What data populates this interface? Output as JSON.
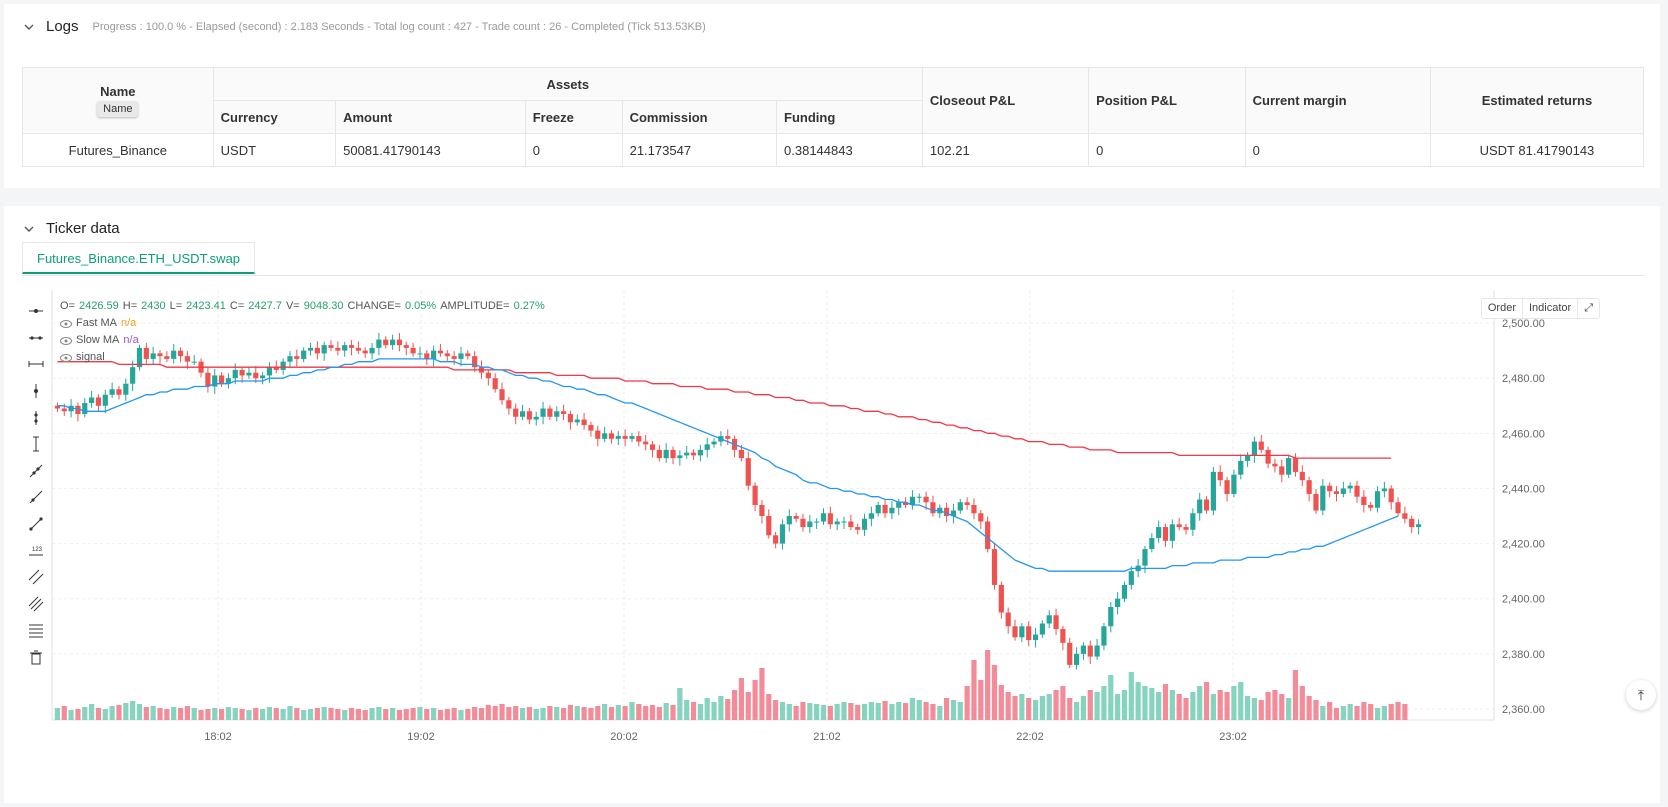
{
  "logs": {
    "title": "Logs",
    "meta": "Progress : 100.0 % - Elapsed (second) : 2.183  Seconds - Total log count : 427 - Trade count : 26 - Completed (Tick 513.53KB)"
  },
  "assets_table": {
    "name_header": "Name",
    "name_tooltip": "Name",
    "assets_header": "Assets",
    "sub_headers": [
      "Currency",
      "Amount",
      "Freeze",
      "Commission",
      "Funding"
    ],
    "other_headers": [
      "Closeout P&L",
      "Position P&L",
      "Current margin",
      "Estimated returns"
    ],
    "row": {
      "name": "Futures_Binance",
      "currency": "USDT",
      "amount": "50081.41790143",
      "freeze": "0",
      "commission": "21.173547",
      "funding": "0.38144843",
      "closeout_pl": "102.21",
      "position_pl": "0",
      "current_margin": "0",
      "estimated_returns": "USDT 81.41790143"
    }
  },
  "ticker": {
    "title": "Ticker data",
    "tab_label": "Futures_Binance.ETH_USDT.swap",
    "buttons": [
      "Order",
      "Indicator"
    ],
    "ohlc": {
      "o_label": "O=",
      "o": "2426.59",
      "h_label": "H=",
      "h": "2430",
      "l_label": "L=",
      "l": "2423.41",
      "c_label": "C=",
      "c": "2427.7",
      "v_label": "V=",
      "v": "9048.30",
      "change_label": "CHANGE=",
      "change": "0.05%",
      "amp_label": "AMPLITUDE=",
      "amp": "0.27%"
    },
    "legend": [
      {
        "name": "Fast MA",
        "value": "n/a",
        "color": "#f0a020"
      },
      {
        "name": "Slow MA",
        "value": "n/a",
        "color": "#9b59b6"
      },
      {
        "name": "signal",
        "value": ""
      }
    ]
  },
  "colors": {
    "up": "#26a69a",
    "down": "#ef5350",
    "fast_ma": "#2196f3",
    "slow_ma": "#f23645",
    "accent": "#0aa07a"
  },
  "chart_data": {
    "type": "candlestick",
    "x_ticks": [
      "18:02",
      "19:02",
      "20:02",
      "21:02",
      "22:02",
      "23:02"
    ],
    "y_ticks": [
      "2,500.00",
      "2,480.00",
      "2,460.00",
      "2,440.00",
      "2,420.00",
      "2,400.00",
      "2,380.00",
      "2,360.00"
    ],
    "y_tick_values": [
      2500,
      2480,
      2460,
      2440,
      2420,
      2400,
      2380,
      2360
    ],
    "ylim": [
      2356,
      2512
    ],
    "closes": [
      2469,
      2468,
      2470,
      2467,
      2471,
      2473,
      2470,
      2474,
      2476,
      2474,
      2478,
      2484,
      2491,
      2487,
      2489,
      2488,
      2487,
      2490,
      2488,
      2486,
      2486,
      2482,
      2477,
      2481,
      2478,
      2480,
      2483,
      2481,
      2482,
      2480,
      2481,
      2484,
      2483,
      2486,
      2488,
      2487,
      2490,
      2491,
      2489,
      2492,
      2491,
      2490,
      2492,
      2491,
      2490,
      2489,
      2491,
      2494,
      2492,
      2494,
      2492,
      2491,
      2489,
      2489,
      2487,
      2490,
      2489,
      2488,
      2487,
      2489,
      2488,
      2484,
      2482,
      2480,
      2476,
      2472,
      2469,
      2466,
      2468,
      2465,
      2466,
      2469,
      2466,
      2468,
      2467,
      2464,
      2465,
      2463,
      2461,
      2458,
      2460,
      2458,
      2459,
      2458,
      2459,
      2457,
      2456,
      2454,
      2451,
      2454,
      2451,
      2452,
      2453,
      2452,
      2454,
      2456,
      2457,
      2459,
      2458,
      2454,
      2451,
      2441,
      2434,
      2430,
      2423,
      2420,
      2427,
      2430,
      2429,
      2426,
      2428,
      2428,
      2431,
      2427,
      2428,
      2428,
      2426,
      2425,
      2429,
      2431,
      2434,
      2431,
      2433,
      2435,
      2434,
      2437,
      2437,
      2435,
      2431,
      2433,
      2430,
      2432,
      2435,
      2434,
      2431,
      2428,
      2418,
      2405,
      2395,
      2390,
      2386,
      2390,
      2385,
      2387,
      2391,
      2394,
      2389,
      2384,
      2376,
      2380,
      2383,
      2379,
      2383,
      2390,
      2397,
      2400,
      2405,
      2410,
      2412,
      2418,
      2422,
      2426,
      2421,
      2427,
      2426,
      2425,
      2431,
      2436,
      2432,
      2446,
      2443,
      2438,
      2445,
      2450,
      2452,
      2457,
      2454,
      2449,
      2448,
      2445,
      2451,
      2446,
      2443,
      2438,
      2432,
      2441,
      2439,
      2438,
      2440,
      2441,
      2437,
      2434,
      2433,
      2439,
      2440,
      2435,
      2431,
      2429,
      2426,
      2427
    ],
    "fast_ma": [
      2470,
      2470,
      2469,
      2469,
      2468,
      2468,
      2468,
      2468,
      2469,
      2470,
      2471,
      2472,
      2473,
      2474,
      2474,
      2475,
      2475,
      2476,
      2476,
      2476,
      2477,
      2477,
      2477,
      2478,
      2478,
      2478,
      2479,
      2479,
      2479,
      2479,
      2479,
      2480,
      2480,
      2480,
      2481,
      2481,
      2482,
      2482,
      2483,
      2483,
      2484,
      2484,
      2485,
      2485,
      2486,
      2486,
      2486,
      2487,
      2487,
      2487,
      2487,
      2487,
      2487,
      2487,
      2487,
      2487,
      2486,
      2486,
      2486,
      2485,
      2485,
      2485,
      2484,
      2484,
      2483,
      2483,
      2482,
      2481,
      2481,
      2480,
      2480,
      2479,
      2479,
      2478,
      2477,
      2477,
      2476,
      2476,
      2475,
      2474,
      2474,
      2473,
      2472,
      2471,
      2471,
      2470,
      2469,
      2468,
      2467,
      2466,
      2465,
      2464,
      2463,
      2462,
      2461,
      2460,
      2459,
      2458,
      2457,
      2456,
      2455,
      2454,
      2453,
      2451,
      2450,
      2448,
      2447,
      2446,
      2445,
      2443,
      2442,
      2442,
      2441,
      2440,
      2440,
      2439,
      2439,
      2438,
      2438,
      2437,
      2437,
      2436,
      2436,
      2435,
      2435,
      2434,
      2434,
      2433,
      2432,
      2432,
      2431,
      2430,
      2429,
      2428,
      2426,
      2424,
      2422,
      2420,
      2418,
      2416,
      2414,
      2413,
      2412,
      2411,
      2411,
      2410,
      2410,
      2410,
      2410,
      2410,
      2410,
      2410,
      2410,
      2410,
      2410,
      2410,
      2410,
      2411,
      2411,
      2411,
      2411,
      2411,
      2411,
      2412,
      2412,
      2412,
      2413,
      2413,
      2413,
      2413,
      2414,
      2414,
      2414,
      2414,
      2415,
      2415,
      2415,
      2415,
      2416,
      2416,
      2417,
      2417,
      2418,
      2418,
      2419,
      2419,
      2420,
      2421,
      2422,
      2423,
      2424,
      2425,
      2426,
      2427,
      2428,
      2429,
      2430
    ],
    "slow_ma": [
      2486,
      2486,
      2486,
      2486,
      2486,
      2486,
      2486,
      2486,
      2486,
      2485,
      2485,
      2485,
      2485,
      2485,
      2485,
      2485,
      2484,
      2484,
      2484,
      2484,
      2484,
      2484,
      2484,
      2484,
      2484,
      2484,
      2484,
      2484,
      2484,
      2484,
      2484,
      2484,
      2484,
      2484,
      2484,
      2484,
      2484,
      2484,
      2484,
      2484,
      2484,
      2484,
      2484,
      2484,
      2484,
      2484,
      2484,
      2484,
      2484,
      2484,
      2484,
      2484,
      2484,
      2484,
      2484,
      2484,
      2484,
      2484,
      2483,
      2483,
      2483,
      2483,
      2483,
      2483,
      2483,
      2483,
      2483,
      2482,
      2482,
      2482,
      2482,
      2482,
      2482,
      2481,
      2481,
      2481,
      2481,
      2481,
      2480,
      2480,
      2480,
      2480,
      2480,
      2479,
      2479,
      2479,
      2479,
      2478,
      2478,
      2478,
      2478,
      2477,
      2477,
      2477,
      2477,
      2476,
      2476,
      2476,
      2476,
      2475,
      2475,
      2475,
      2474,
      2474,
      2474,
      2473,
      2473,
      2473,
      2472,
      2472,
      2471,
      2471,
      2471,
      2470,
      2470,
      2470,
      2469,
      2469,
      2468,
      2468,
      2468,
      2467,
      2467,
      2466,
      2466,
      2466,
      2465,
      2465,
      2464,
      2464,
      2463,
      2463,
      2462,
      2462,
      2461,
      2461,
      2460,
      2460,
      2459,
      2459,
      2458,
      2458,
      2457,
      2457,
      2457,
      2456,
      2456,
      2456,
      2455,
      2455,
      2455,
      2454,
      2454,
      2454,
      2454,
      2453,
      2453,
      2453,
      2453,
      2453,
      2453,
      2453,
      2453,
      2453,
      2452,
      2452,
      2452,
      2452,
      2452,
      2452,
      2452,
      2452,
      2452,
      2452,
      2452,
      2452,
      2452,
      2452,
      2452,
      2452,
      2452,
      2451,
      2451,
      2451,
      2451,
      2451,
      2451,
      2451,
      2451,
      2451,
      2451,
      2451,
      2451,
      2451,
      2451,
      2451
    ],
    "volumes": [
      12,
      14,
      10,
      11,
      13,
      16,
      12,
      11,
      14,
      15,
      17,
      19,
      16,
      13,
      14,
      12,
      11,
      13,
      12,
      14,
      12,
      10,
      11,
      12,
      11,
      13,
      12,
      11,
      10,
      12,
      11,
      13,
      12,
      11,
      14,
      12,
      10,
      11,
      12,
      13,
      12,
      11,
      10,
      12,
      11,
      10,
      12,
      13,
      11,
      12,
      10,
      11,
      12,
      13,
      11,
      12,
      10,
      11,
      12,
      10,
      11,
      13,
      12,
      15,
      14,
      16,
      13,
      14,
      12,
      13,
      11,
      12,
      14,
      13,
      12,
      15,
      14,
      13,
      12,
      14,
      16,
      13,
      15,
      14,
      18,
      16,
      14,
      15,
      13,
      17,
      15,
      32,
      20,
      18,
      16,
      22,
      18,
      24,
      21,
      30,
      42,
      28,
      40,
      52,
      26,
      20,
      18,
      16,
      14,
      18,
      17,
      16,
      15,
      14,
      16,
      18,
      17,
      15,
      16,
      18,
      17,
      19,
      16,
      18,
      17,
      22,
      20,
      18,
      16,
      14,
      22,
      20,
      18,
      34,
      60,
      40,
      70,
      55,
      35,
      28,
      24,
      26,
      22,
      20,
      24,
      26,
      30,
      34,
      22,
      18,
      24,
      30,
      28,
      34,
      45,
      26,
      30,
      48,
      38,
      34,
      32,
      28,
      36,
      30,
      26,
      22,
      28,
      34,
      38,
      26,
      30,
      28,
      34,
      38,
      24,
      22,
      20,
      28,
      30,
      26,
      22,
      50,
      34,
      24,
      20,
      14,
      18,
      12,
      14,
      16,
      14,
      18,
      16,
      12,
      14,
      16,
      18,
      16
    ]
  }
}
